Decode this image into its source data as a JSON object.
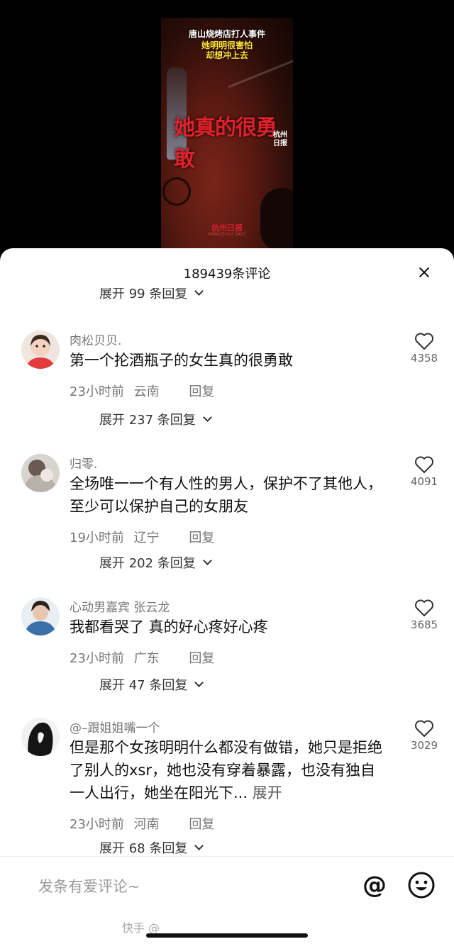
{
  "video": {
    "caption_line1": "唐山烧烤店打人事件",
    "caption_line2": "她明明很害怕",
    "caption_line3": "却想冲上去",
    "big_text": "她真的很勇敢",
    "tag": "杭州日报",
    "logo": "杭州日报",
    "logo_sub": "HANGZHOU DAILY"
  },
  "sheet": {
    "title": "189439条评论",
    "top_expand": "展开 99 条回复"
  },
  "comments": [
    {
      "user": "肉松贝贝.",
      "text": "第一个抡酒瓶子的女生真的很勇敢",
      "time": "23小时前",
      "location": "云南",
      "reply": "回复",
      "likes": "4358",
      "expand": "展开 237 条回复"
    },
    {
      "user": "归零.",
      "text": "全场唯一一个有人性的男人，保护不了其他人，至少可以保护自己的女朋友",
      "time": "19小时前",
      "location": "辽宁",
      "reply": "回复",
      "likes": "4091",
      "expand": "展开 202 条回复"
    },
    {
      "user": "心动男嘉宾 张云龙",
      "text": "我都看哭了 真的好心疼好心疼",
      "time": "23小时前",
      "location": "广东",
      "reply": "回复",
      "likes": "3685",
      "expand": "展开 47 条回复"
    },
    {
      "user": "@–跟姐姐嘴一个",
      "text": "但是那个女孩明明什么都没有做错，她只是拒绝了别人的xsr，她也没有穿着暴露，也没有独自一人出行，她坐在阳光下...",
      "more": "展开",
      "time": "23小时前",
      "location": "河南",
      "reply": "回复",
      "likes": "3029",
      "expand": "展开 68 条回复"
    }
  ],
  "input": {
    "placeholder": "发条有爱评论~",
    "at_symbol": "@"
  },
  "watermark": "快手 @",
  "icons": {
    "close": "close-icon",
    "like": "heart-outline-icon",
    "mention": "at-icon",
    "emoji": "smiley-icon",
    "expand": "chevron-down-icon"
  }
}
